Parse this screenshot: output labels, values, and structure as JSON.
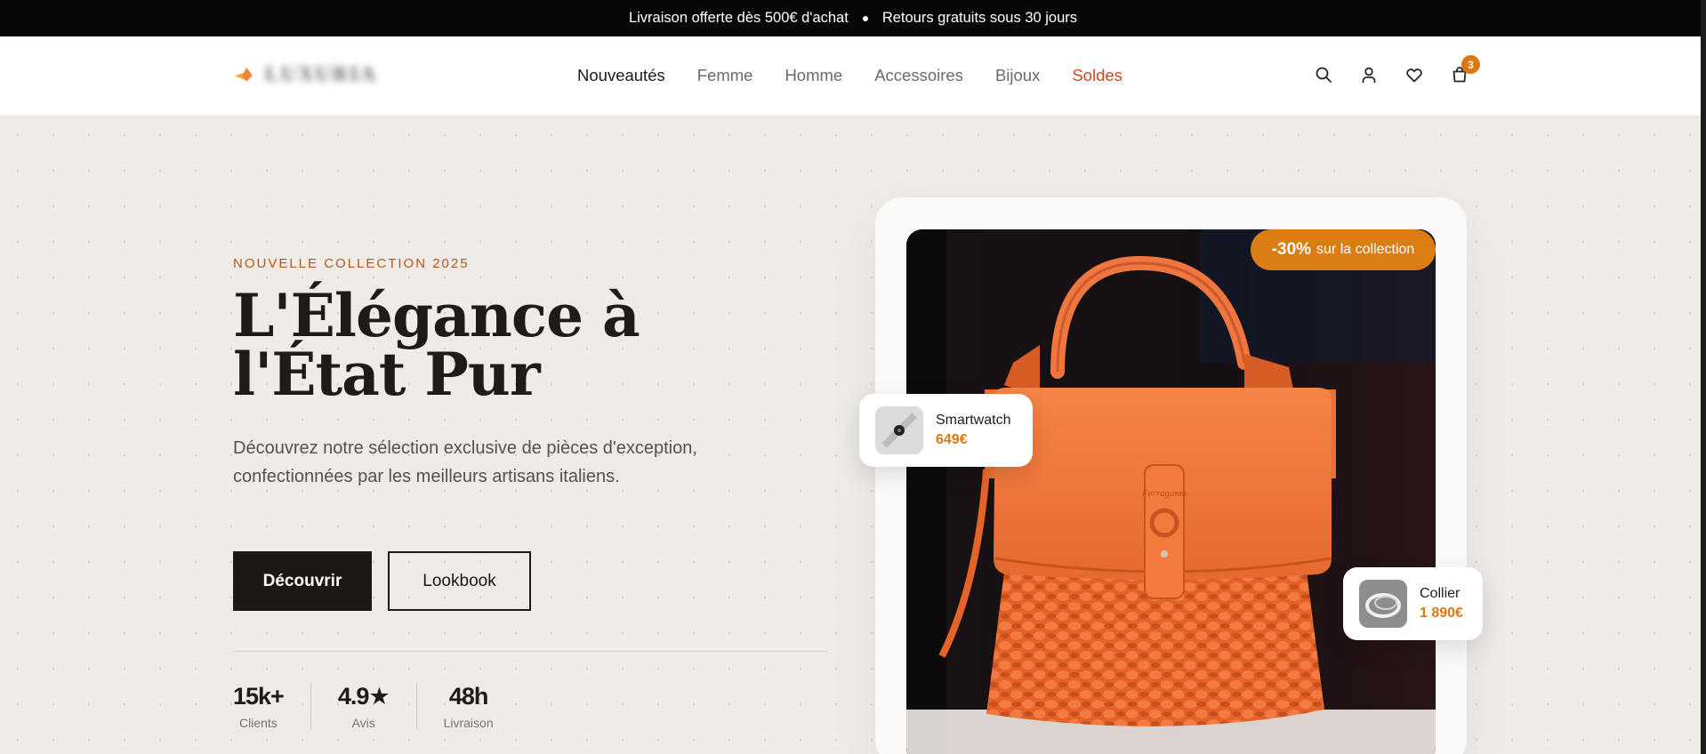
{
  "announcement": {
    "left": "Livraison offerte dès 500€ d'achat",
    "right": "Retours gratuits sous 30 jours"
  },
  "header": {
    "logo_text": "LUXURIA",
    "nav": [
      {
        "label": "Nouveautés"
      },
      {
        "label": "Femme"
      },
      {
        "label": "Homme"
      },
      {
        "label": "Accessoires"
      },
      {
        "label": "Bijoux"
      },
      {
        "label": "Soldes"
      }
    ],
    "icons": [
      "search-icon",
      "user-icon",
      "heart-icon",
      "bag-icon"
    ],
    "cart_count": "3"
  },
  "hero": {
    "eyebrow": "NOUVELLE COLLECTION 2025",
    "title_line1": "L'Élégance à",
    "title_line2": "l'État Pur",
    "lead": "Découvrez notre sélection exclusive de pièces d'exception, confectionnées par les meilleurs artisans italiens.",
    "primary_button": "Découvrir",
    "secondary_button": "Lookbook",
    "stats": [
      {
        "value": "15k+",
        "label": "Clients"
      },
      {
        "value": "4.9★",
        "label": "Avis"
      },
      {
        "value": "48h",
        "label": "Livraison"
      }
    ]
  },
  "product": {
    "promo_percent": "-30%",
    "promo_text": "sur la collection",
    "floating": [
      {
        "name": "Smartwatch",
        "price": "649€"
      },
      {
        "name": "Collier",
        "price": "1 890€"
      }
    ]
  },
  "colors": {
    "accent": "#dc7813",
    "sale": "#d2471e",
    "dark": "#1b1816",
    "background": "#efebe6"
  }
}
